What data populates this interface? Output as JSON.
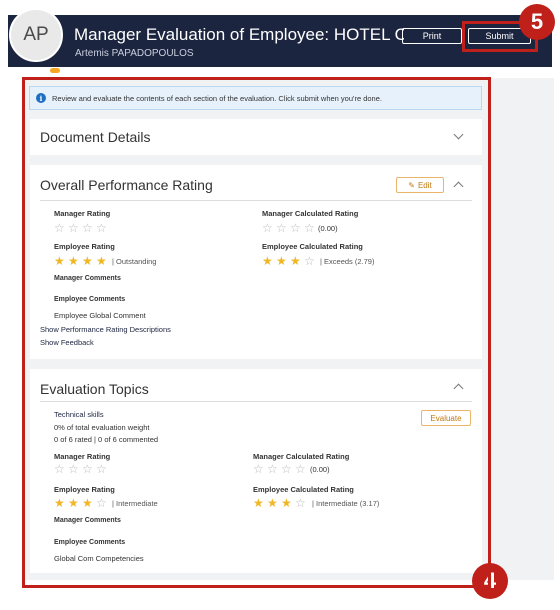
{
  "header": {
    "avatar_initials": "AP",
    "title": "Manager Evaluation of Employee: HOTEL OPE…",
    "subtitle": "Artemis PAPADOPOULOS",
    "print_label": "Print",
    "submit_label": "Submit",
    "bg_color": "#1c2540"
  },
  "annotations": {
    "badge_submit": "5",
    "badge_content": "4",
    "highlight_color": "#c0201a"
  },
  "info_banner": {
    "text": "Review and evaluate the contents of each section of the evaluation. Click submit when you're done."
  },
  "document_details": {
    "title": "Document Details"
  },
  "overall": {
    "title": "Overall Performance Rating",
    "edit_label": "Edit",
    "manager_rating_label": "Manager Rating",
    "manager_calc_label": "Manager Calculated Rating",
    "manager_calc_value": "(0.00)",
    "employee_rating_label": "Employee Rating",
    "employee_rating_value": "| Outstanding",
    "employee_rating_stars": 4,
    "employee_calc_label": "Employee Calculated Rating",
    "employee_calc_value": "| Exceeds (2.79)",
    "employee_calc_stars": 3,
    "manager_comments_label": "Manager Comments",
    "employee_comments_label": "Employee Comments",
    "employee_comment_text": "Employee Global Comment",
    "link_descriptions": "Show Performance Rating Descriptions",
    "link_feedback": "Show Feedback"
  },
  "topics": {
    "title": "Evaluation Topics",
    "topic_name": "Technical skills",
    "weight_text": "0% of total evaluation weight",
    "rated_text": "0 of 6 rated | 0 of 6 commented",
    "evaluate_label": "Evaluate",
    "manager_rating_label": "Manager Rating",
    "manager_calc_label": "Manager Calculated Rating",
    "manager_calc_value": "(0.00)",
    "employee_rating_label": "Employee Rating",
    "employee_rating_value": "| Intermediate",
    "employee_rating_stars": 3,
    "employee_calc_label": "Employee Calculated Rating",
    "employee_calc_value": "| Intermediate (3.17)",
    "employee_calc_stars": 3,
    "manager_comments_label": "Manager Comments",
    "employee_comments_label": "Employee Comments",
    "employee_comment_text": "Global Com Competencies"
  }
}
